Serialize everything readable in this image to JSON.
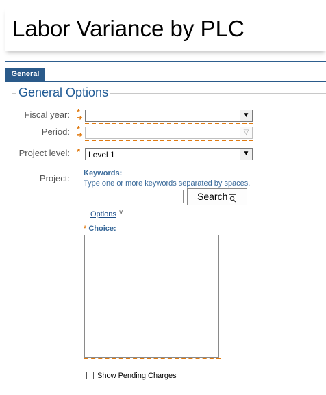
{
  "page": {
    "title": "Labor Variance by PLC"
  },
  "tabs": [
    {
      "label": "General",
      "active": true
    }
  ],
  "section": {
    "legend": "General Options"
  },
  "fields": {
    "fiscal_year": {
      "label": "Fiscal year:",
      "value": "",
      "required": true
    },
    "period": {
      "label": "Period:",
      "value": "",
      "required": true,
      "disabled": true
    },
    "project_level": {
      "label": "Project level:",
      "value": "Level 1",
      "required": true
    },
    "project": {
      "label": "Project:",
      "keywords_label": "Keywords:",
      "keywords_hint": "Type one or more keywords separated by spaces.",
      "keywords_value": "",
      "search_button": "Search",
      "options_link": "Options",
      "choice_label": "Choice:",
      "choice_required": true
    },
    "show_pending": {
      "label": "Show Pending Charges",
      "checked": false
    }
  },
  "colors": {
    "accent_blue": "#1f5a95",
    "tab_blue": "#2a5a8a",
    "required_orange": "#e07a10"
  },
  "icons": {
    "required": "asterisk-arrow-icon",
    "dropdown": "chevron-down-icon",
    "search": "magnifier-document-icon",
    "options": "chevron-down-small-icon"
  }
}
